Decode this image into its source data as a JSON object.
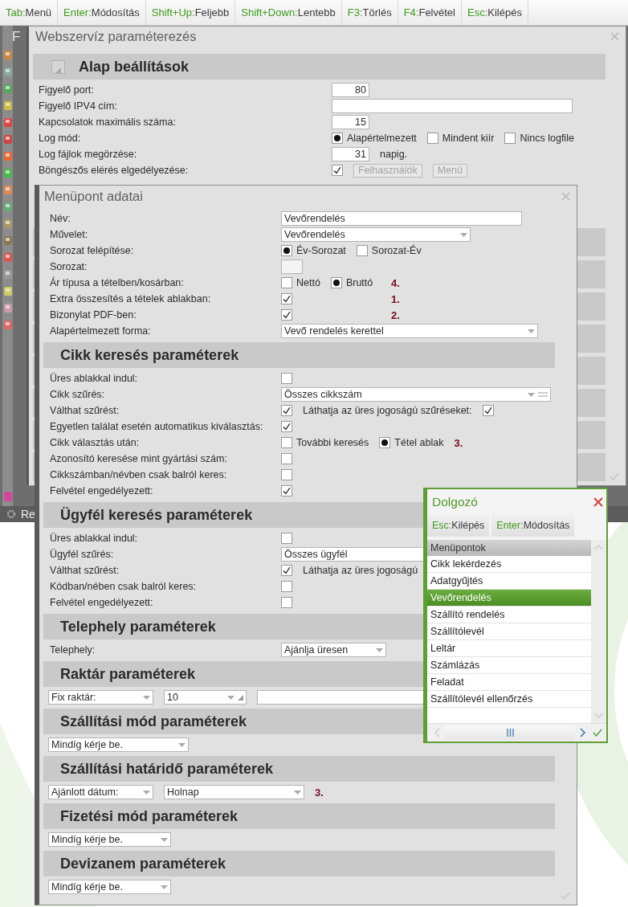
{
  "shortcut_bar": [
    {
      "key": "Tab:",
      "action": "Menü"
    },
    {
      "key": "Enter:",
      "action": "Módosítás"
    },
    {
      "key": "Shift+Up:",
      "action": "Feljebb"
    },
    {
      "key": "Shift+Down:",
      "action": "Lentebb"
    },
    {
      "key": "F3:",
      "action": "Törlés"
    },
    {
      "key": "F4:",
      "action": "Felvétel"
    },
    {
      "key": "Esc:",
      "action": "Kilépés"
    }
  ],
  "app": {
    "tab_label": "F",
    "footer_label": "Re"
  },
  "settings_window": {
    "title": "Webszervíz paraméterezés",
    "section": "Alap beállítások",
    "rows": [
      {
        "label": "Figyelő port:",
        "controls": [
          {
            "kind": "number",
            "value": "80"
          }
        ]
      },
      {
        "label": "Figyelő IPV4 cím:",
        "controls": [
          {
            "kind": "text"
          }
        ]
      },
      {
        "label": "Kapcsolatok maximális száma:",
        "controls": [
          {
            "kind": "number",
            "value": "15"
          }
        ]
      },
      {
        "label": "Log mód:",
        "controls": [
          {
            "kind": "radio",
            "label": "Alapértelmezett",
            "selected": true
          },
          {
            "kind": "radio",
            "label": "Mindent kiír",
            "selected": false
          },
          {
            "kind": "radio",
            "label": "Nincs logfile",
            "selected": false
          }
        ]
      },
      {
        "label": "Log fájlok megörzése:",
        "controls": [
          {
            "kind": "number",
            "value": "31"
          },
          {
            "kind": "suffix",
            "text": "napig."
          }
        ]
      },
      {
        "label": "Böngészős elérés elgedélyezése:",
        "controls": [
          {
            "kind": "check",
            "checked": true
          },
          {
            "kind": "button",
            "label": "Felhasználók",
            "disabled": true
          },
          {
            "kind": "button",
            "label": "Menü",
            "disabled": true
          }
        ]
      }
    ]
  },
  "menu_window": {
    "title": "Menüpont adatai",
    "rows": [
      {
        "label": "Név:",
        "controls": [
          {
            "kind": "text",
            "value": "Vevőrendelés"
          }
        ]
      },
      {
        "label": "Művelet:",
        "controls": [
          {
            "kind": "select",
            "value": "Vevőrendelés"
          }
        ]
      },
      {
        "label": "Sorozat felépítése:",
        "controls": [
          {
            "kind": "radio",
            "label": "Év-Sorozat",
            "selected": true
          },
          {
            "kind": "radio",
            "label": "Sorozat-Év",
            "selected": false
          }
        ]
      },
      {
        "label": "Sorozat:",
        "controls": [
          {
            "kind": "short-text"
          }
        ]
      },
      {
        "label": "Ár típusa a tételben/kosárban:",
        "controls": [
          {
            "kind": "radio",
            "label": "Nettó",
            "selected": false
          },
          {
            "kind": "radio",
            "label": "Bruttó",
            "selected": true
          }
        ],
        "note": "4."
      },
      {
        "label": "Extra összesítés a tételek ablakban:",
        "controls": [
          {
            "kind": "check",
            "checked": true
          }
        ],
        "note": "1."
      },
      {
        "label": "Bizonylat PDF-ben:",
        "controls": [
          {
            "kind": "check",
            "checked": true
          }
        ],
        "note": "2."
      },
      {
        "label": "Alapértelmezett forma:",
        "controls": [
          {
            "kind": "wide-select",
            "value": "Vevő rendelés kerettel"
          }
        ]
      }
    ],
    "sections": [
      {
        "title": "Cikk keresés paraméterek",
        "rows": [
          {
            "label": "Üres ablakkal indul:",
            "controls": [
              {
                "kind": "check",
                "checked": false
              }
            ]
          },
          {
            "label": "Cikk szűrés:",
            "controls": [
              {
                "kind": "filter-select",
                "value": "Összes cikkszám"
              }
            ]
          },
          {
            "label": "Válthat szűrést:",
            "controls": [
              {
                "kind": "check",
                "checked": true
              },
              {
                "kind": "suffix",
                "text": "Láthatja az üres jogoságú szűréseket:"
              },
              {
                "kind": "check",
                "checked": true
              }
            ]
          },
          {
            "label": "Egyetlen találat esetén automatikus kiválasztás:",
            "controls": [
              {
                "kind": "check",
                "checked": true
              }
            ]
          },
          {
            "label": "Cikk választás után:",
            "controls": [
              {
                "kind": "radio",
                "label": "További keresés",
                "selected": false
              },
              {
                "kind": "radio",
                "label": "Tétel ablak",
                "selected": true
              }
            ],
            "note": "3."
          },
          {
            "label": "Azonosító keresése mint gyártási szám:",
            "controls": [
              {
                "kind": "check",
                "checked": false
              }
            ]
          },
          {
            "label": "Cikkszámban/névben csak balról keres:",
            "controls": [
              {
                "kind": "check",
                "checked": false
              }
            ]
          },
          {
            "label": "Felvétel engedélyezett:",
            "controls": [
              {
                "kind": "check",
                "checked": true
              }
            ]
          }
        ]
      },
      {
        "title": "Ügyfél keresés paraméterek",
        "rows": [
          {
            "label": "Üres ablakkal indul:",
            "controls": [
              {
                "kind": "check",
                "checked": false
              }
            ]
          },
          {
            "label": "Ügyfél szűrés:",
            "controls": [
              {
                "kind": "wide-select",
                "value": "Összes ügyfél"
              }
            ]
          },
          {
            "label": "Válthat szűrést:",
            "controls": [
              {
                "kind": "check",
                "checked": true
              },
              {
                "kind": "suffix",
                "text": "Láthatja az üres jogoságú"
              }
            ]
          },
          {
            "label": "Kódban/nében csak balról keres:",
            "controls": [
              {
                "kind": "check",
                "checked": false
              }
            ]
          },
          {
            "label": "Felvétel engedélyezett:",
            "controls": [
              {
                "kind": "check",
                "checked": false
              }
            ]
          }
        ]
      },
      {
        "title": "Telephely paraméterek",
        "rows": [
          {
            "label": "Telephely:",
            "controls": [
              {
                "kind": "short-select",
                "value": "Ajánlja üresen"
              }
            ]
          }
        ]
      },
      {
        "title": "Raktár paraméterek",
        "rows": [
          {
            "controls": [
              {
                "kind": "short-select",
                "value": "Fix raktár:"
              },
              {
                "kind": "spin-select",
                "value": "10"
              },
              {
                "kind": "text"
              }
            ]
          }
        ]
      },
      {
        "title": "Szállítási mód paraméterek",
        "rows": [
          {
            "controls": [
              {
                "kind": "mid-select",
                "value": "Mindíg kérje be."
              }
            ]
          }
        ]
      },
      {
        "title": "Szállítási határidő paraméterek",
        "rows": [
          {
            "controls": [
              {
                "kind": "short-select",
                "value": "Ajánlott dátum:"
              },
              {
                "kind": "mid-select",
                "value": "Holnap"
              }
            ],
            "note": "3."
          }
        ]
      },
      {
        "title": "Fizetési mód paraméterek",
        "rows": [
          {
            "controls": [
              {
                "kind": "medium-select",
                "value": "Mindíg kérje be."
              }
            ]
          }
        ]
      },
      {
        "title": "Devizanem paraméterek",
        "rows": [
          {
            "controls": [
              {
                "kind": "medium-select",
                "value": "Mindíg kérje be."
              }
            ]
          }
        ]
      }
    ]
  },
  "employee_panel": {
    "title": "Dolgozó",
    "buttons": [
      {
        "key": "Esc:",
        "action": "Kilépés"
      },
      {
        "key": "Enter:",
        "action": "Módosítás"
      }
    ],
    "list_header": "Menüpontok",
    "items": [
      {
        "label": "Cikk lekérdezés",
        "selected": false
      },
      {
        "label": "Adatgyűjtés",
        "selected": false
      },
      {
        "label": "Vevőrendelés",
        "selected": true
      },
      {
        "label": "Szállító rendelés",
        "selected": false
      },
      {
        "label": "Szállítólevél",
        "selected": false
      },
      {
        "label": "Leltár",
        "selected": false
      },
      {
        "label": "Számlázás",
        "selected": false
      },
      {
        "label": "Feladat",
        "selected": false
      },
      {
        "label": "Szállítólevél ellenőrzés",
        "selected": false
      }
    ]
  }
}
